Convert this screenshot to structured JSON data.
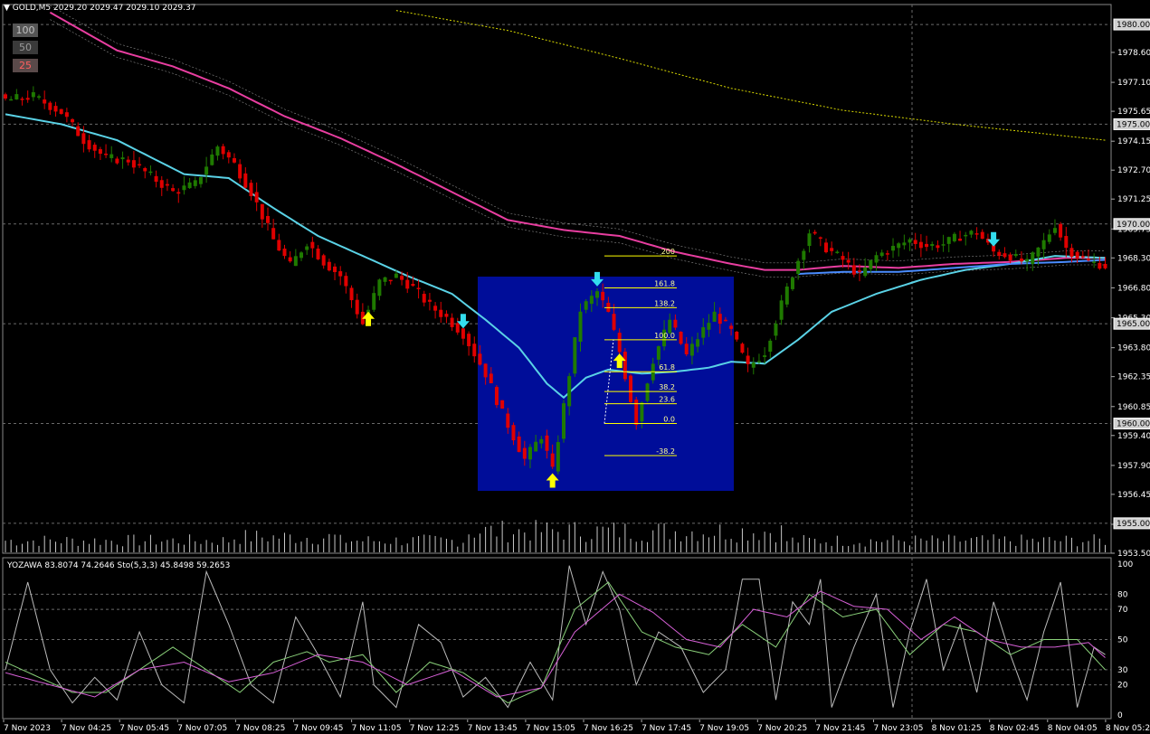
{
  "symbol_header": "GOLD,M5  2029.20 2029.47 2029.10 2029.37",
  "osc_header": "YOZAWA 83.8074 74.2646  Sto(5,3,3) 45.8498 59.2653",
  "zoom_buttons": [
    {
      "label": "100",
      "color": "#c0c0c0",
      "bg": "#555555"
    },
    {
      "label": "50",
      "color": "#9a9a9a",
      "bg": "#3a3a3a"
    },
    {
      "label": "25",
      "color": "#ff6060",
      "bg": "#5a4a4a"
    }
  ],
  "colors": {
    "bear": "#e00000",
    "bull": "#1f7a00",
    "ema_cyan": "#5ad2e6",
    "ma_pink": "#e83ea0",
    "ma_yellow": "#d8d800",
    "fib_box": "#000d99",
    "fib_line": "#ffff00",
    "arrow_up": "#ffff00",
    "arrow_down": "#33ddee",
    "volume": "#c8c8c8",
    "grid": "#6a6a6a",
    "osc_white": "#bbbbbb",
    "osc_green": "#8ad17a",
    "osc_magenta": "#d860d8"
  },
  "chart_data": [
    {
      "type": "candlestick",
      "title": "GOLD,M5",
      "ylim": [
        1953.5,
        1981.0
      ],
      "y_ticks": [
        1953.5,
        1954.95,
        1956.45,
        1957.9,
        1959.4,
        1960.85,
        1962.35,
        1963.8,
        1965.3,
        1966.8,
        1968.3,
        1969.75,
        1971.25,
        1972.7,
        1974.15,
        1975.65,
        1977.1,
        1978.6
      ],
      "y_tick_labels": [
        "1953.50",
        "1954.95",
        "1956.45",
        "1957.90",
        "1959.40",
        "1960.85",
        "1962.35",
        "1963.80",
        "1965.30",
        "1966.80",
        "1968.30",
        "1969.75",
        "1971.25",
        "1972.70",
        "1974.15",
        "1975.65",
        "1977.10",
        "1978.60"
      ],
      "price_markers": [
        1980.0,
        1975.0,
        1970.0,
        1965.0,
        1960.0,
        1955.0
      ],
      "price_marker_labels": [
        "1980.00",
        "1975.00",
        "1970.00",
        "1965.00",
        "1960.00",
        "1955.00"
      ],
      "x_labels": [
        "7 Nov 2023",
        "7 Nov 04:25",
        "7 Nov 05:45",
        "7 Nov 07:05",
        "7 Nov 08:25",
        "7 Nov 09:45",
        "7 Nov 11:05",
        "7 Nov 12:25",
        "7 Nov 13:45",
        "7 Nov 15:05",
        "7 Nov 16:25",
        "7 Nov 17:45",
        "7 Nov 19:05",
        "7 Nov 20:25",
        "7 Nov 21:45",
        "7 Nov 23:05",
        "8 Nov 01:25",
        "8 Nov 02:45",
        "8 Nov 04:05",
        "8 Nov 05:25"
      ],
      "close_anchors": [
        [
          0,
          1976.2
        ],
        [
          5,
          1976.4
        ],
        [
          10,
          1975.6
        ],
        [
          14,
          1974.2
        ],
        [
          18,
          1973.3
        ],
        [
          22,
          1973.2
        ],
        [
          26,
          1972.4
        ],
        [
          30,
          1971.6
        ],
        [
          34,
          1972.0
        ],
        [
          38,
          1973.9
        ],
        [
          41,
          1973.0
        ],
        [
          44,
          1971.6
        ],
        [
          48,
          1969.2
        ],
        [
          51,
          1967.9
        ],
        [
          54,
          1969.1
        ],
        [
          57,
          1968.1
        ],
        [
          60,
          1967.4
        ],
        [
          64,
          1965.0
        ],
        [
          67,
          1967.1
        ],
        [
          70,
          1967.4
        ],
        [
          73,
          1966.8
        ],
        [
          76,
          1965.9
        ],
        [
          79,
          1965.3
        ],
        [
          82,
          1964.5
        ],
        [
          86,
          1962.5
        ],
        [
          89,
          1960.5
        ],
        [
          93,
          1958.2
        ],
        [
          96,
          1959.4
        ],
        [
          98,
          1957.6
        ],
        [
          101,
          1962.5
        ],
        [
          103,
          1965.7
        ],
        [
          106,
          1966.6
        ],
        [
          108,
          1965.5
        ],
        [
          110,
          1963.6
        ],
        [
          112,
          1961.2
        ],
        [
          113,
          1960.1
        ],
        [
          116,
          1963.2
        ],
        [
          119,
          1965.2
        ],
        [
          122,
          1963.4
        ],
        [
          124,
          1964.3
        ],
        [
          127,
          1965.5
        ],
        [
          130,
          1964.6
        ],
        [
          133,
          1962.8
        ],
        [
          136,
          1963.6
        ],
        [
          138,
          1965.2
        ],
        [
          141,
          1967.5
        ],
        [
          144,
          1969.6
        ],
        [
          147,
          1968.8
        ],
        [
          150,
          1968.2
        ],
        [
          153,
          1967.4
        ],
        [
          156,
          1968.4
        ],
        [
          159,
          1968.8
        ],
        [
          162,
          1969.2
        ],
        [
          165,
          1968.9
        ],
        [
          168,
          1969.0
        ],
        [
          171,
          1969.4
        ],
        [
          174,
          1969.6
        ],
        [
          177,
          1968.6
        ],
        [
          180,
          1968.4
        ],
        [
          183,
          1968.0
        ],
        [
          186,
          1969.1
        ],
        [
          188,
          1970.0
        ],
        [
          190,
          1968.8
        ],
        [
          192,
          1968.4
        ],
        [
          194,
          1968.1
        ],
        [
          196,
          1968.0
        ],
        [
          197,
          1967.9
        ]
      ],
      "ema_cyan_anchors": [
        [
          0,
          1975.5
        ],
        [
          10,
          1975.0
        ],
        [
          20,
          1974.2
        ],
        [
          32,
          1972.5
        ],
        [
          40,
          1972.3
        ],
        [
          48,
          1970.8
        ],
        [
          56,
          1969.4
        ],
        [
          64,
          1968.4
        ],
        [
          72,
          1967.4
        ],
        [
          80,
          1966.5
        ],
        [
          86,
          1965.2
        ],
        [
          92,
          1963.8
        ],
        [
          97,
          1962.0
        ],
        [
          100,
          1961.3
        ],
        [
          104,
          1962.3
        ],
        [
          108,
          1962.7
        ],
        [
          114,
          1962.5
        ],
        [
          120,
          1962.6
        ],
        [
          126,
          1962.8
        ],
        [
          130,
          1963.1
        ],
        [
          136,
          1963.0
        ],
        [
          142,
          1964.2
        ],
        [
          148,
          1965.6
        ],
        [
          156,
          1966.5
        ],
        [
          164,
          1967.2
        ],
        [
          172,
          1967.7
        ],
        [
          180,
          1968.0
        ],
        [
          188,
          1968.4
        ],
        [
          197,
          1968.3
        ]
      ],
      "ema_blue_anchors": [
        [
          142,
          1967.5
        ],
        [
          150,
          1967.6
        ],
        [
          160,
          1967.6
        ],
        [
          170,
          1967.8
        ],
        [
          180,
          1968.0
        ],
        [
          190,
          1968.1
        ],
        [
          197,
          1968.2
        ]
      ],
      "ma_pink_anchors": [
        [
          8,
          1980.6
        ],
        [
          20,
          1978.7
        ],
        [
          30,
          1977.9
        ],
        [
          40,
          1976.8
        ],
        [
          50,
          1975.4
        ],
        [
          60,
          1974.3
        ],
        [
          70,
          1973.0
        ],
        [
          80,
          1971.6
        ],
        [
          90,
          1970.2
        ],
        [
          100,
          1969.7
        ],
        [
          110,
          1969.4
        ],
        [
          120,
          1968.6
        ],
        [
          130,
          1968.0
        ],
        [
          136,
          1967.7
        ],
        [
          142,
          1967.7
        ],
        [
          150,
          1967.9
        ],
        [
          160,
          1967.8
        ],
        [
          170,
          1968.0
        ],
        [
          180,
          1968.1
        ],
        [
          190,
          1968.3
        ],
        [
          197,
          1968.3
        ]
      ],
      "ma_yellow_anchors": [
        [
          70,
          1980.7
        ],
        [
          90,
          1979.7
        ],
        [
          110,
          1978.3
        ],
        [
          130,
          1976.8
        ],
        [
          150,
          1975.7
        ],
        [
          170,
          1975.0
        ],
        [
          197,
          1974.2
        ]
      ],
      "arrows": [
        {
          "bar": 65,
          "dir": "up"
        },
        {
          "bar": 82,
          "dir": "down"
        },
        {
          "bar": 98,
          "dir": "up"
        },
        {
          "bar": 106,
          "dir": "down"
        },
        {
          "bar": 110,
          "dir": "up"
        },
        {
          "bar": 177,
          "dir": "down"
        }
      ],
      "fibonacci": {
        "price_0": 1960.0,
        "price_100": 1964.2,
        "levels": [
          {
            "ratio": 2.0,
            "label": "200"
          },
          {
            "ratio": 1.618,
            "label": "161.8"
          },
          {
            "ratio": 1.382,
            "label": "138.2"
          },
          {
            "ratio": 1.0,
            "label": "100.0"
          },
          {
            "ratio": 0.618,
            "label": "61.8"
          },
          {
            "ratio": 0.382,
            "label": "38.2"
          },
          {
            "ratio": 0.236,
            "label": "23.6"
          },
          {
            "ratio": 0.0,
            "label": "0.0"
          },
          {
            "ratio": -0.382,
            "label": "-38.2"
          }
        ]
      }
    },
    {
      "type": "line",
      "title": "YOZAWA / Sto(5,3,3)",
      "ylim": [
        0,
        100
      ],
      "y_tick_labels": [
        "100",
        "80",
        "70",
        "50",
        "30",
        "20",
        "0"
      ],
      "y_ticks": [
        100,
        80,
        70,
        50,
        30,
        20,
        0
      ],
      "series": [
        {
          "name": "YOZAWA",
          "values": [
            83.8074,
            74.2646
          ]
        },
        {
          "name": "Sto(5,3,3)",
          "values": [
            45.8498,
            59.2653
          ]
        }
      ],
      "white_anchors": [
        [
          0,
          30
        ],
        [
          4,
          88
        ],
        [
          8,
          30
        ],
        [
          12,
          8
        ],
        [
          16,
          25
        ],
        [
          20,
          10
        ],
        [
          24,
          55
        ],
        [
          28,
          20
        ],
        [
          32,
          8
        ],
        [
          36,
          95
        ],
        [
          40,
          60
        ],
        [
          44,
          20
        ],
        [
          48,
          8
        ],
        [
          52,
          65
        ],
        [
          56,
          40
        ],
        [
          60,
          12
        ],
        [
          64,
          75
        ],
        [
          66,
          20
        ],
        [
          70,
          5
        ],
        [
          74,
          60
        ],
        [
          78,
          48
        ],
        [
          82,
          12
        ],
        [
          86,
          25
        ],
        [
          90,
          5
        ],
        [
          94,
          35
        ],
        [
          98,
          10
        ],
        [
          101,
          99
        ],
        [
          104,
          60
        ],
        [
          107,
          95
        ],
        [
          110,
          70
        ],
        [
          113,
          20
        ],
        [
          117,
          55
        ],
        [
          121,
          45
        ],
        [
          125,
          15
        ],
        [
          129,
          30
        ],
        [
          132,
          90
        ],
        [
          135,
          90
        ],
        [
          138,
          10
        ],
        [
          141,
          75
        ],
        [
          144,
          60
        ],
        [
          146,
          90
        ],
        [
          148,
          5
        ],
        [
          152,
          45
        ],
        [
          156,
          80
        ],
        [
          159,
          5
        ],
        [
          162,
          55
        ],
        [
          165,
          90
        ],
        [
          168,
          30
        ],
        [
          171,
          60
        ],
        [
          174,
          15
        ],
        [
          177,
          75
        ],
        [
          180,
          40
        ],
        [
          183,
          10
        ],
        [
          186,
          55
        ],
        [
          189,
          88
        ],
        [
          192,
          5
        ],
        [
          195,
          45
        ],
        [
          197,
          40
        ]
      ],
      "green_anchors": [
        [
          0,
          35
        ],
        [
          6,
          25
        ],
        [
          12,
          15
        ],
        [
          18,
          15
        ],
        [
          24,
          30
        ],
        [
          30,
          45
        ],
        [
          36,
          30
        ],
        [
          42,
          15
        ],
        [
          48,
          35
        ],
        [
          54,
          42
        ],
        [
          58,
          35
        ],
        [
          64,
          40
        ],
        [
          70,
          15
        ],
        [
          76,
          35
        ],
        [
          82,
          28
        ],
        [
          90,
          8
        ],
        [
          96,
          18
        ],
        [
          102,
          70
        ],
        [
          108,
          88
        ],
        [
          114,
          55
        ],
        [
          120,
          45
        ],
        [
          126,
          40
        ],
        [
          132,
          60
        ],
        [
          138,
          45
        ],
        [
          144,
          80
        ],
        [
          150,
          65
        ],
        [
          156,
          70
        ],
        [
          162,
          40
        ],
        [
          168,
          60
        ],
        [
          174,
          55
        ],
        [
          180,
          40
        ],
        [
          186,
          50
        ],
        [
          192,
          50
        ],
        [
          197,
          30
        ]
      ],
      "magenta_anchors": [
        [
          0,
          28
        ],
        [
          8,
          20
        ],
        [
          16,
          12
        ],
        [
          24,
          30
        ],
        [
          32,
          35
        ],
        [
          40,
          22
        ],
        [
          48,
          28
        ],
        [
          56,
          40
        ],
        [
          64,
          35
        ],
        [
          72,
          20
        ],
        [
          80,
          30
        ],
        [
          88,
          12
        ],
        [
          96,
          18
        ],
        [
          102,
          55
        ],
        [
          110,
          80
        ],
        [
          116,
          68
        ],
        [
          122,
          50
        ],
        [
          128,
          45
        ],
        [
          134,
          70
        ],
        [
          140,
          65
        ],
        [
          146,
          82
        ],
        [
          152,
          72
        ],
        [
          158,
          70
        ],
        [
          164,
          50
        ],
        [
          170,
          65
        ],
        [
          176,
          50
        ],
        [
          182,
          45
        ],
        [
          188,
          45
        ],
        [
          194,
          48
        ],
        [
          197,
          38
        ]
      ]
    }
  ]
}
